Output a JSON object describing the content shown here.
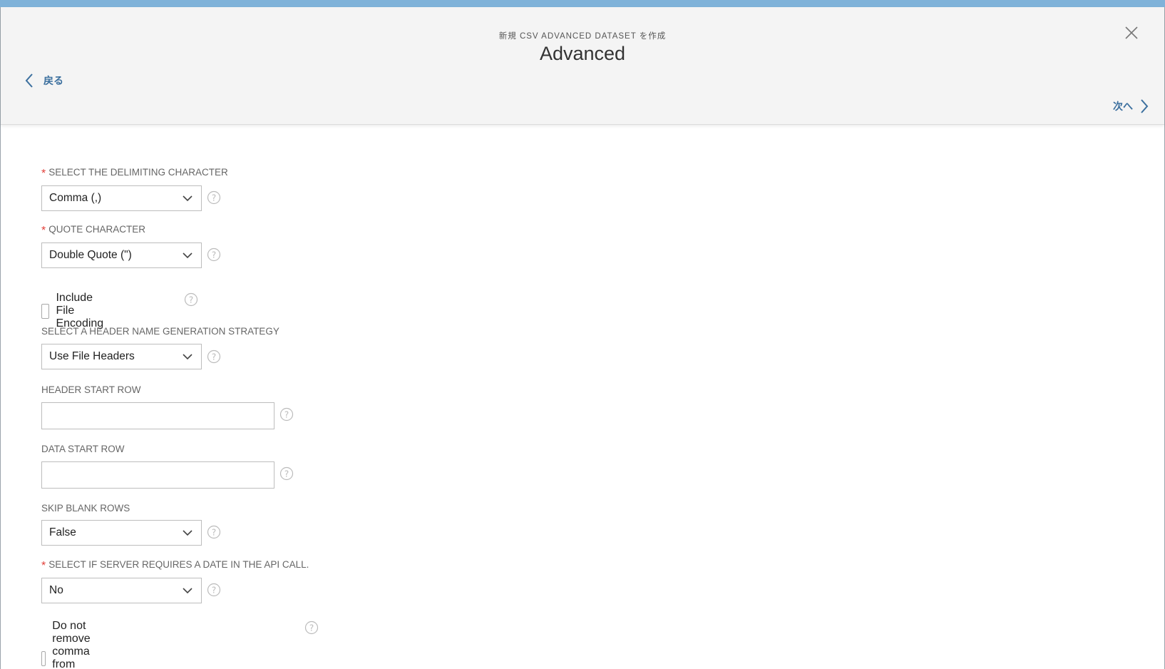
{
  "header": {
    "subtitle": "新規 CSV ADVANCED DATASET を作成",
    "title": "Advanced",
    "back_label": "戻る",
    "next_label": "次へ"
  },
  "form": {
    "delimiter": {
      "label": "SELECT THE DELIMITING CHARACTER",
      "required": "*",
      "value": "Comma (,)"
    },
    "quote": {
      "label": "QUOTE CHARACTER",
      "required": "*",
      "value": "Double Quote (\")"
    },
    "include_encoding": {
      "label": "Include File Encoding"
    },
    "header_strategy": {
      "label": "SELECT A HEADER NAME GENERATION STRATEGY",
      "value": "Use File Headers"
    },
    "header_start_row": {
      "label": "HEADER START ROW",
      "value": ""
    },
    "data_start_row": {
      "label": "DATA START ROW",
      "value": ""
    },
    "skip_blank_rows": {
      "label": "SKIP BLANK ROWS",
      "value": "False"
    },
    "date_required": {
      "label": "SELECT IF SERVER REQUIRES A DATE IN THE API CALL.",
      "required": "*",
      "value": "No"
    },
    "keep_commas": {
      "label": "Do not remove comma from number values"
    }
  },
  "colors": {
    "accent": "#3b6f9e",
    "required": "#e2403a",
    "top_strip": "#7fb2d9"
  }
}
